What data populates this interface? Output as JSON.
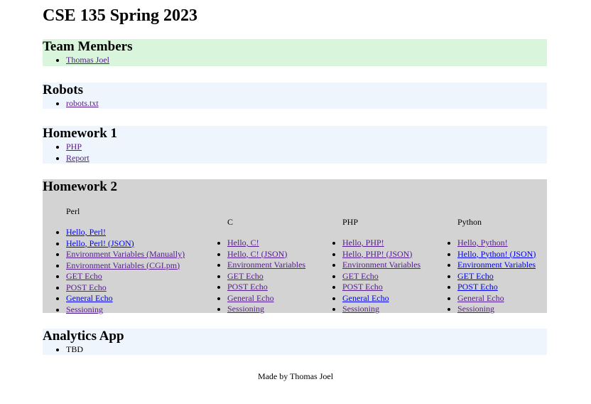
{
  "page": {
    "title": "CSE 135 Spring 2023"
  },
  "team": {
    "heading": "Team Members",
    "items": [
      "Thomas Joel"
    ]
  },
  "robots": {
    "heading": "Robots",
    "items": [
      "robots.txt"
    ]
  },
  "hw1": {
    "heading": "Homework 1",
    "items": [
      "PHP",
      "Report"
    ]
  },
  "hw2": {
    "heading": "Homework 2",
    "columns": [
      {
        "name": "Perl",
        "items": [
          "Hello, Perl!",
          "Hello, Perl! (JSON)",
          "Environment Variables (Manually)",
          "Environment Variables (CGI.pm)",
          "GET Echo",
          "POST Echo",
          "General Echo",
          "Sessioning"
        ]
      },
      {
        "name": "C",
        "items": [
          "Hello, C!",
          "Hello, C! (JSON)",
          "Environment Variables",
          "GET Echo",
          "POST Echo",
          "General Echo",
          "Sessioning"
        ]
      },
      {
        "name": "PHP",
        "items": [
          "Hello, PHP!",
          "Hello, PHP! (JSON)",
          "Environment Variables",
          "GET Echo",
          "POST Echo",
          "General Echo",
          "Sessioning"
        ]
      },
      {
        "name": "Python",
        "items": [
          "Hello, Python!",
          "Hello, Python! (JSON)",
          "Environment Variables",
          "GET Echo",
          "POST Echo",
          "General Echo",
          "Sessioning"
        ]
      }
    ]
  },
  "analytics": {
    "heading": "Analytics App",
    "items": [
      "TBD"
    ]
  },
  "footer": {
    "text": "Made by Thomas Joel"
  },
  "colors": {
    "team_bg": "#d9f5dc",
    "section_bg": "#eef5fd",
    "hw2_bg": "#d3d3d3",
    "visited_link": "#551a8b",
    "link": "#0000ee"
  }
}
